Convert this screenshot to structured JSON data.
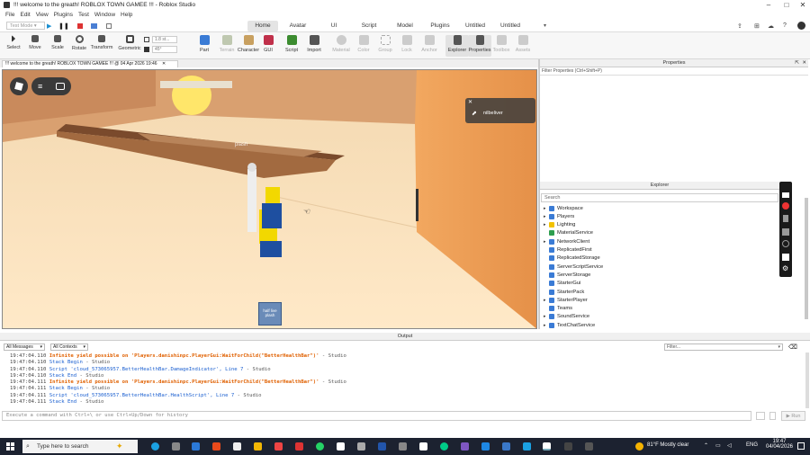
{
  "window": {
    "title": "!!! welcome to the greath! ROBLOX TOWN GAMEE !!! - Roblox Studio"
  },
  "menu": [
    "File",
    "Edit",
    "View",
    "Plugins",
    "Test",
    "Window",
    "Help"
  ],
  "test_mode": "Test Mode",
  "ribbon_tabs": [
    "Home",
    "Avatar",
    "UI",
    "Script",
    "Model",
    "Plugins",
    "Untitled",
    "Untitled"
  ],
  "active_ribbon_tab": "Home",
  "tools": {
    "select": "Select",
    "move": "Move",
    "scale": "Scale",
    "rotate": "Rotate",
    "transform": "Transform",
    "geometric": "Geometric",
    "stud_value": "1.8 st...",
    "angle_value": "45°",
    "part": "Part",
    "terrain": "Terrain",
    "character": "Character",
    "gui": "GUI",
    "script": "Script",
    "import": "Import",
    "material": "Material",
    "color": "Color",
    "group": "Group",
    "lock": "Lock",
    "anchor": "Anchor",
    "explorer": "Explorer",
    "properties": "Properties",
    "toolbox": "Toolbox",
    "assets": "Assets"
  },
  "doc_tab": "!!! welcome to the greath! ROBLOX TOWN GAMEE !!! @ 04 Apr 2026 19:46",
  "viewport": {
    "player_notice": "nilbeliver",
    "player_nametag": "plash",
    "tool_label": "half live plash"
  },
  "properties": {
    "title": "Properties",
    "filter_placeholder": "Filter Properties (Ctrl+Shift+P)"
  },
  "explorer": {
    "title": "Explorer",
    "search_placeholder": "Search",
    "items": [
      {
        "name": "Workspace",
        "expandable": true,
        "color": "#3a7bd5"
      },
      {
        "name": "Players",
        "expandable": true,
        "color": "#3a7bd5"
      },
      {
        "name": "Lighting",
        "expandable": true,
        "color": "#f2c200"
      },
      {
        "name": "MaterialService",
        "expandable": false,
        "color": "#2e9e4f"
      },
      {
        "name": "NetworkClient",
        "expandable": true,
        "color": "#3a7bd5"
      },
      {
        "name": "ReplicatedFirst",
        "expandable": false,
        "color": "#3a7bd5"
      },
      {
        "name": "ReplicatedStorage",
        "expandable": false,
        "color": "#3a7bd5"
      },
      {
        "name": "ServerScriptService",
        "expandable": false,
        "color": "#3a7bd5"
      },
      {
        "name": "ServerStorage",
        "expandable": false,
        "color": "#3a7bd5"
      },
      {
        "name": "StarterGui",
        "expandable": false,
        "color": "#3a7bd5"
      },
      {
        "name": "StarterPack",
        "expandable": false,
        "color": "#3a7bd5"
      },
      {
        "name": "StarterPlayer",
        "expandable": true,
        "color": "#3a7bd5"
      },
      {
        "name": "Teams",
        "expandable": false,
        "color": "#3a7bd5"
      },
      {
        "name": "SoundService",
        "expandable": true,
        "color": "#3a7bd5"
      },
      {
        "name": "TextChatService",
        "expandable": true,
        "color": "#3a7bd5"
      }
    ]
  },
  "output": {
    "title": "Output",
    "messages_filter": "All Messages",
    "contexts_filter": "All Contexts",
    "filter_placeholder": "Filter...",
    "lines": [
      {
        "ts": "19:47:04.110",
        "text": "Infinite yield possible on 'Players.danishinpc.PlayerGui:WaitForChild(\"BetterHealthBar\")'",
        "src": "-  Studio",
        "kind": "warn"
      },
      {
        "ts": "19:47:04.110",
        "text": "Stack Begin",
        "src": "-  Studio",
        "kind": "info"
      },
      {
        "ts": "19:47:04.110",
        "text": "Script 'cloud_573065957.BetterHealthBar.DamageIndicator', Line 7",
        "src": "-  Studio",
        "kind": "info"
      },
      {
        "ts": "19:47:04.110",
        "text": "Stack End",
        "src": "-  Studio",
        "kind": "info"
      },
      {
        "ts": "19:47:04.111",
        "text": "Infinite yield possible on 'Players.danishinpc.PlayerGui:WaitForChild(\"BetterHealthBar\")'",
        "src": "-  Studio",
        "kind": "warn"
      },
      {
        "ts": "19:47:04.111",
        "text": "Stack Begin",
        "src": "-  Studio",
        "kind": "info"
      },
      {
        "ts": "19:47:04.111",
        "text": "Script 'cloud_573065957.BetterHealthBar.HealthScript', Line 7",
        "src": "-  Studio",
        "kind": "info"
      },
      {
        "ts": "19:47:04.111",
        "text": "Stack End",
        "src": "-  Studio",
        "kind": "info"
      }
    ],
    "command_placeholder": "Execute a command with Ctrl+\\ or use Ctrl+Up/Down for history",
    "run_label": "Run"
  },
  "taskbar": {
    "search_placeholder": "Type here to search",
    "weather": "81°F  Mostly clear",
    "lang": "ENG",
    "time": "19:47",
    "date": "04/04/2026"
  }
}
